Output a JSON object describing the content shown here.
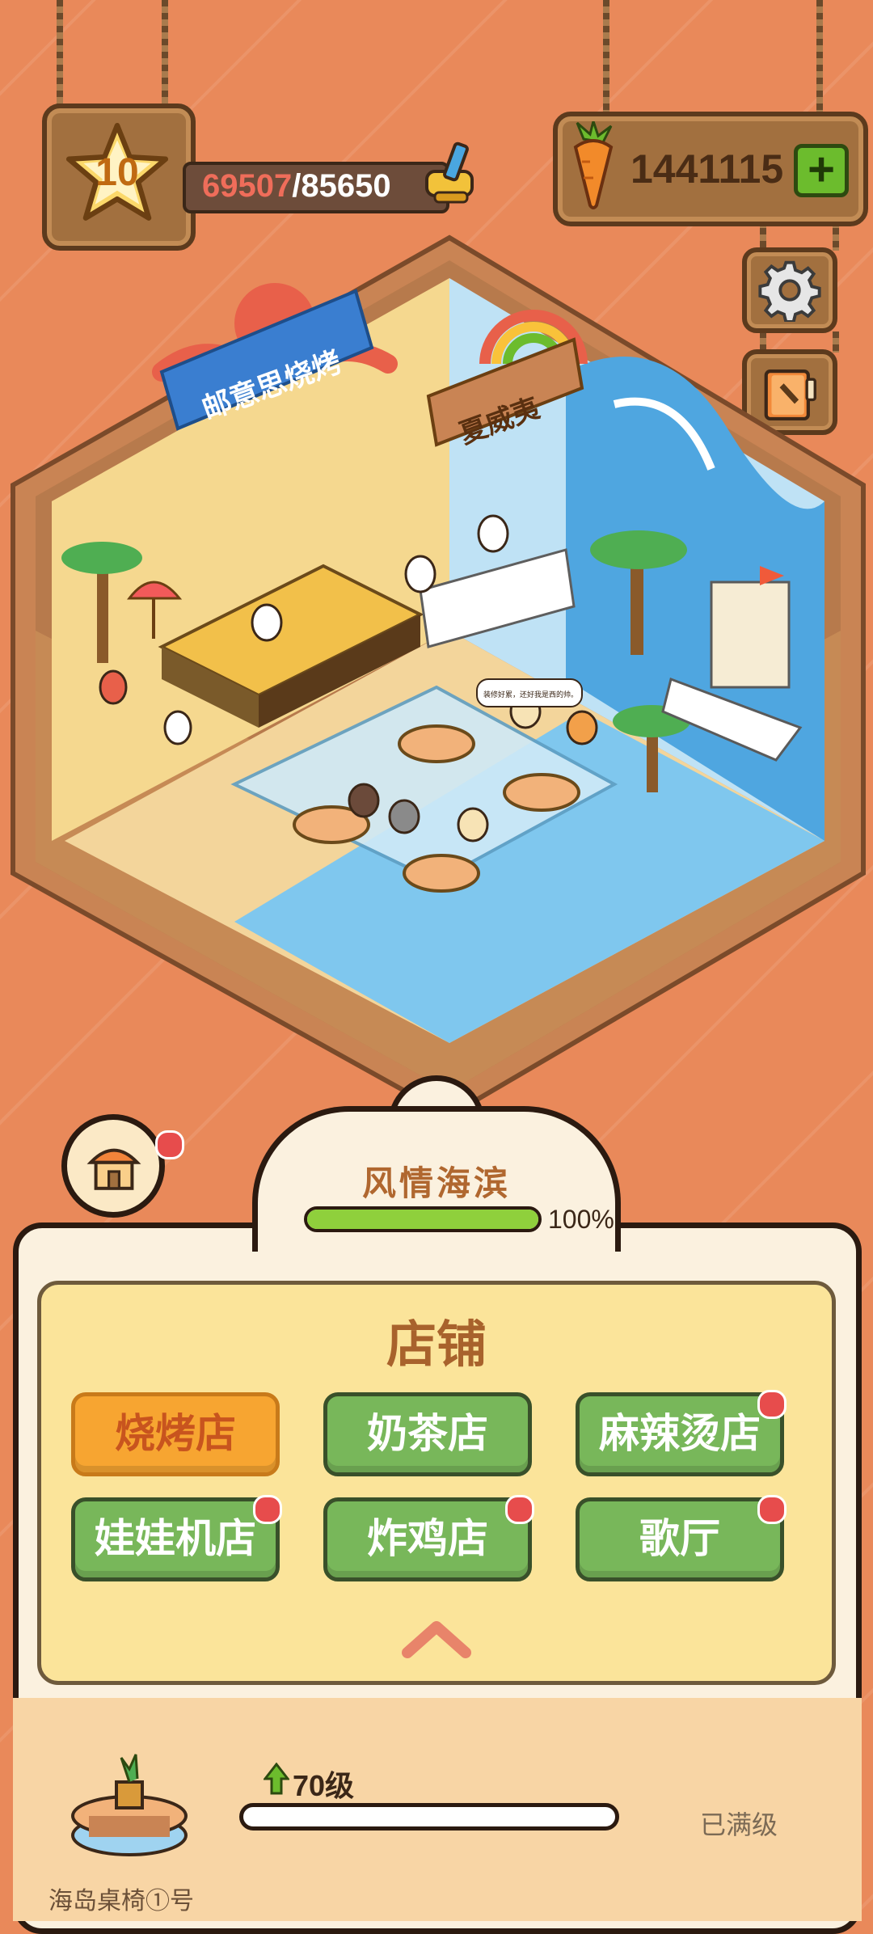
{
  "hud": {
    "level": "10",
    "xp_current": "69507",
    "xp_separator": "/",
    "xp_max": "85650",
    "carrots": "1441115",
    "add_label": "+"
  },
  "scene": {
    "sign_left": "邮意思烧烤",
    "sign_right": "夏威夷",
    "speech_bubble": "装修好累，还好我是西的帅。"
  },
  "area": {
    "name": "风情海滨",
    "progress_fraction": 1.0,
    "progress_label": "100%"
  },
  "shops": {
    "title": "店铺",
    "items": [
      {
        "label": "烧烤店",
        "active": true,
        "dot": false
      },
      {
        "label": "奶茶店",
        "active": false,
        "dot": false
      },
      {
        "label": "麻辣烫店",
        "active": false,
        "dot": true
      },
      {
        "label": "娃娃机店",
        "active": false,
        "dot": true
      },
      {
        "label": "炸鸡店",
        "active": false,
        "dot": true
      },
      {
        "label": "歌厅",
        "active": false,
        "dot": true
      }
    ]
  },
  "item": {
    "name": "海岛桌椅①号",
    "level": "70级",
    "status": "已满级"
  },
  "colors": {
    "background": "#e9895a",
    "active_shop": "#f7a531",
    "shop": "#78b75a",
    "progress": "#8fd03c"
  }
}
